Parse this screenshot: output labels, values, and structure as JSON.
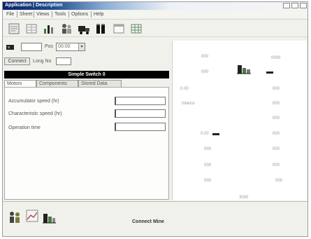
{
  "window": {
    "title": "Application | Description"
  },
  "menu": {
    "items": [
      "File",
      "Sheet",
      "Views",
      "Tools",
      "Options",
      "Help"
    ]
  },
  "toolbar": {
    "icons": [
      "document-icon",
      "grid-icon",
      "bar-chart-icon",
      "people-icon",
      "truck-icon",
      "tanks-icon",
      "window-icon",
      "table-icon"
    ]
  },
  "filter": {
    "id_value": "",
    "pos_label": "Pos",
    "pos_value": "00:00",
    "connect_label": "Connect",
    "long_label": "Long No",
    "long_value": ""
  },
  "section": {
    "title": "Simple Switch 0",
    "tabs": [
      "Motors",
      "Components",
      "Stored Data"
    ],
    "active_tab": 0
  },
  "form": {
    "fields": [
      {
        "label": "Accumulator speed (hr)",
        "value": ""
      },
      {
        "label": "Characteristic speed (hr)",
        "value": ""
      },
      {
        "label": "Operation time",
        "value": ""
      }
    ]
  },
  "right_panel": {
    "rows": [
      {
        "left": "000",
        "right": "0000"
      },
      {
        "left": "000",
        "right": ""
      },
      {
        "left": "0.00",
        "right": "000"
      },
      {
        "left": "Interior",
        "right": "000"
      },
      {
        "left": "",
        "right": "000"
      },
      {
        "left": "0.00",
        "right": "000"
      },
      {
        "left": "000",
        "right": "000"
      },
      {
        "left": "000",
        "right": "000"
      },
      {
        "left": "000",
        "right": "000"
      }
    ],
    "footer": "3000"
  },
  "bottom": {
    "icons": [
      "people-icon",
      "chart-icon",
      "flask-icon"
    ],
    "status_text": "Connect Mine"
  },
  "colors": {
    "title_bar": "#0a246a",
    "section_header": "#000000",
    "window_bg": "#f1f1ec"
  }
}
